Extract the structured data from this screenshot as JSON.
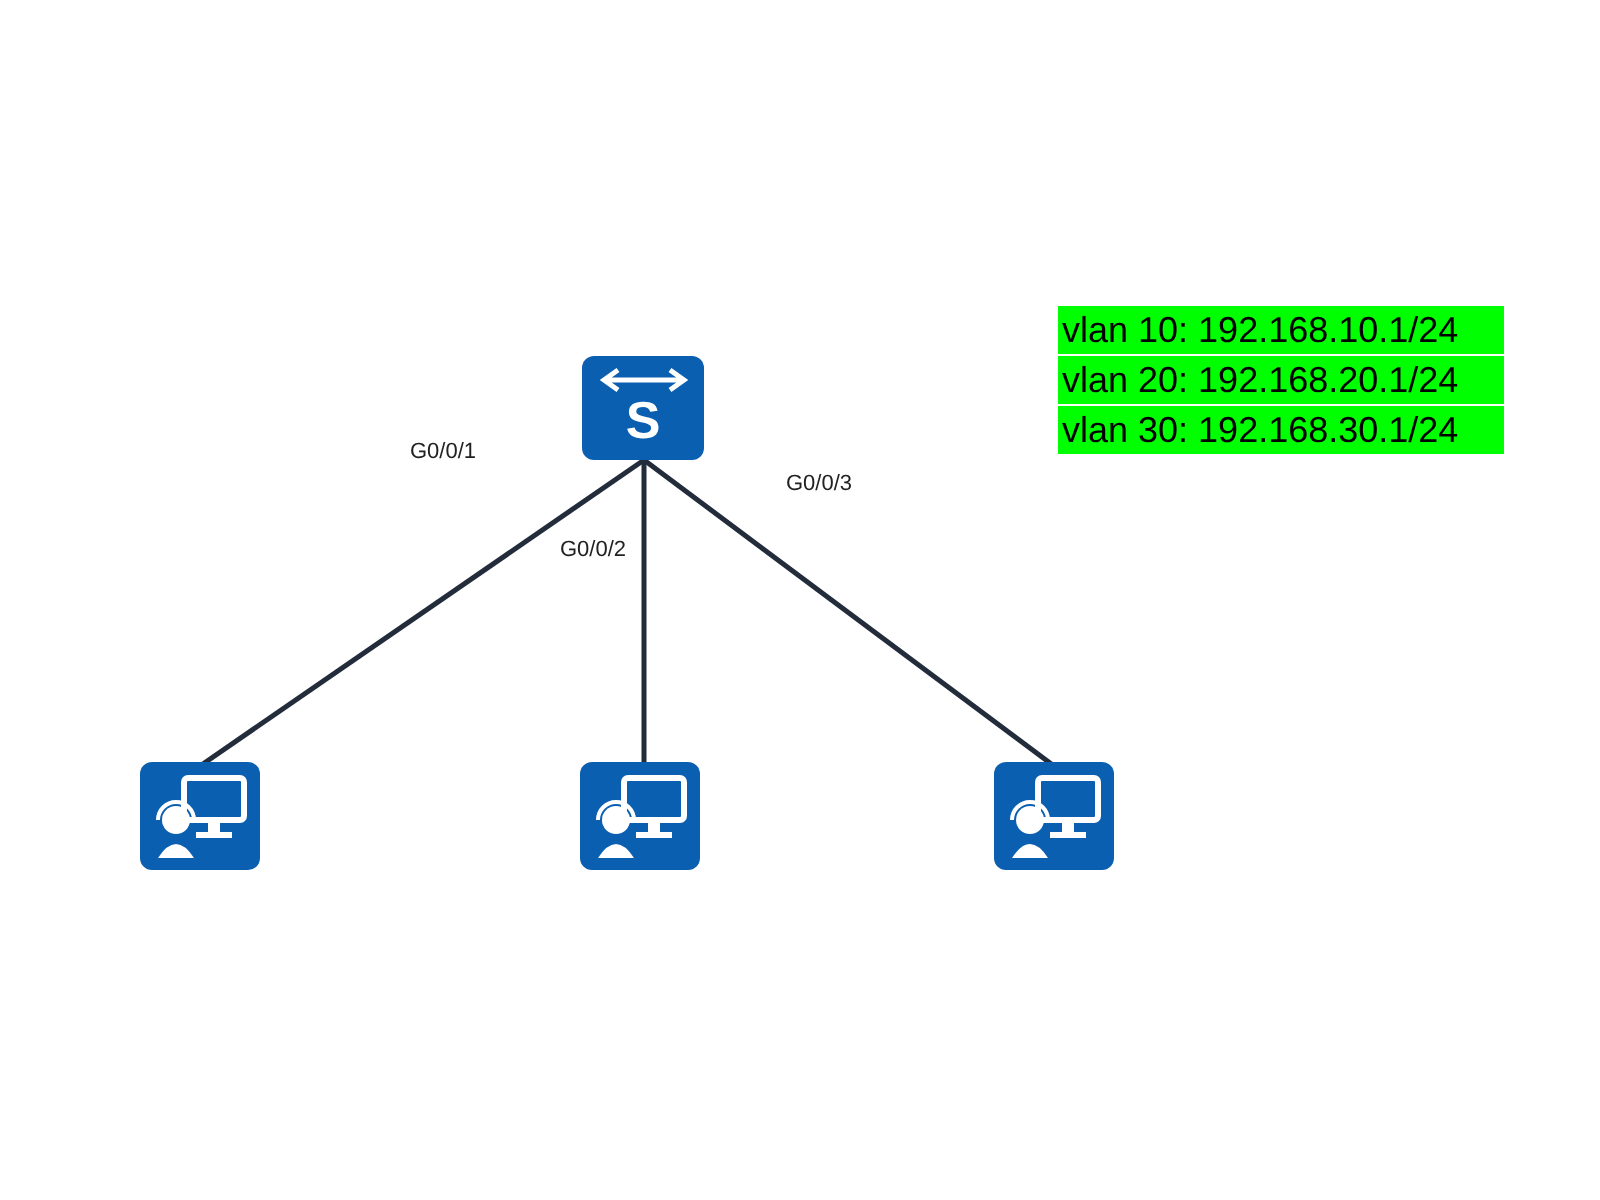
{
  "switch": {
    "letter": "S"
  },
  "links": [
    {
      "port": "G0/0/1"
    },
    {
      "port": "G0/0/2"
    },
    {
      "port": "G0/0/3"
    }
  ],
  "vlan_notes": [
    "vlan 10: 192.168.10.1/24",
    "vlan 20: 192.168.20.1/24",
    "vlan 30: 192.168.30.1/24"
  ]
}
